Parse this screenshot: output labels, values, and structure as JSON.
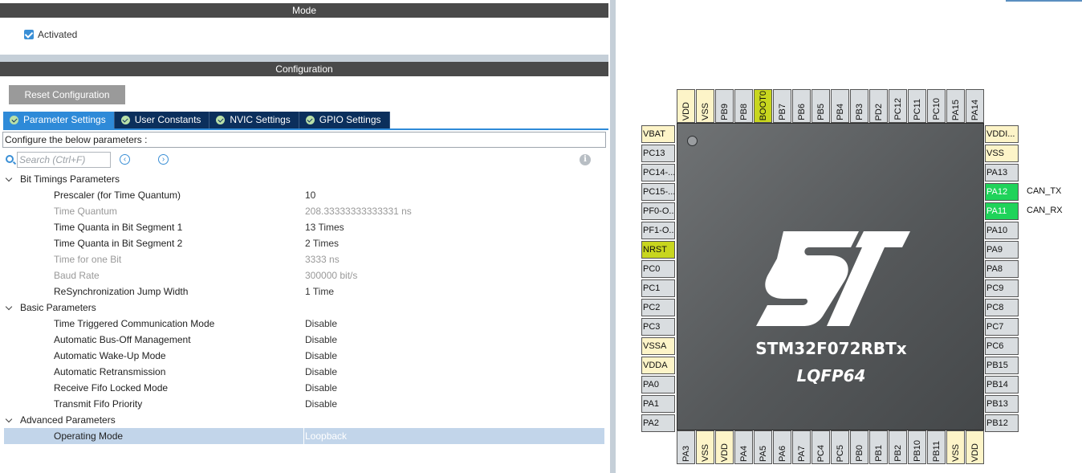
{
  "mode": {
    "title": "Mode",
    "activated_label": "Activated",
    "activated_checked": true
  },
  "configuration": {
    "title": "Configuration",
    "reset_label": "Reset Configuration",
    "tabs": [
      {
        "label": "Parameter Settings",
        "active": true
      },
      {
        "label": "User Constants",
        "active": false
      },
      {
        "label": "NVIC Settings",
        "active": false
      },
      {
        "label": "GPIO Settings",
        "active": false
      }
    ],
    "configure_text": "Configure the below parameters :",
    "search_placeholder": "Search (Ctrl+F)",
    "info_glyph": "i",
    "groups": [
      {
        "label": "Bit Timings Parameters",
        "params": [
          {
            "label": "Prescaler (for Time Quantum)",
            "value": "10",
            "dim": false
          },
          {
            "label": "Time Quantum",
            "value": "208.33333333333331 ns",
            "dim": true
          },
          {
            "label": "Time Quanta in Bit Segment 1",
            "value": "13 Times",
            "dim": false
          },
          {
            "label": "Time Quanta in Bit Segment 2",
            "value": "2 Times",
            "dim": false
          },
          {
            "label": "Time for one Bit",
            "value": "3333 ns",
            "dim": true
          },
          {
            "label": "Baud Rate",
            "value": "300000 bit/s",
            "dim": true
          },
          {
            "label": "ReSynchronization Jump Width",
            "value": "1 Time",
            "dim": false
          }
        ]
      },
      {
        "label": "Basic Parameters",
        "params": [
          {
            "label": "Time Triggered Communication Mode",
            "value": "Disable",
            "dim": false
          },
          {
            "label": "Automatic Bus-Off Management",
            "value": "Disable",
            "dim": false
          },
          {
            "label": "Automatic Wake-Up Mode",
            "value": "Disable",
            "dim": false
          },
          {
            "label": "Automatic Retransmission",
            "value": "Disable",
            "dim": false
          },
          {
            "label": "Receive Fifo Locked Mode",
            "value": "Disable",
            "dim": false
          },
          {
            "label": "Transmit Fifo Priority",
            "value": "Disable",
            "dim": false
          }
        ]
      },
      {
        "label": "Advanced Parameters",
        "params": [
          {
            "label": "Operating Mode",
            "value": "Loopback",
            "dim": false,
            "selected": true
          }
        ]
      }
    ]
  },
  "chip": {
    "name": "STM32F072RBTx",
    "package": "LQFP64",
    "pins_top": [
      {
        "name": "VDD",
        "type": "power"
      },
      {
        "name": "VSS",
        "type": "power"
      },
      {
        "name": "PB9",
        "type": "io"
      },
      {
        "name": "PB8",
        "type": "io"
      },
      {
        "name": "BOOT0",
        "type": "yellow"
      },
      {
        "name": "PB7",
        "type": "io"
      },
      {
        "name": "PB6",
        "type": "io"
      },
      {
        "name": "PB5",
        "type": "io"
      },
      {
        "name": "PB4",
        "type": "io"
      },
      {
        "name": "PB3",
        "type": "io"
      },
      {
        "name": "PD2",
        "type": "io"
      },
      {
        "name": "PC12",
        "type": "io"
      },
      {
        "name": "PC11",
        "type": "io"
      },
      {
        "name": "PC10",
        "type": "io"
      },
      {
        "name": "PA15",
        "type": "io"
      },
      {
        "name": "PA14",
        "type": "io"
      }
    ],
    "pins_left": [
      {
        "name": "VBAT",
        "type": "power"
      },
      {
        "name": "PC13",
        "type": "io"
      },
      {
        "name": "PC14-...",
        "type": "io"
      },
      {
        "name": "PC15-...",
        "type": "io"
      },
      {
        "name": "PF0-O...",
        "type": "io"
      },
      {
        "name": "PF1-O...",
        "type": "io"
      },
      {
        "name": "NRST",
        "type": "yellow"
      },
      {
        "name": "PC0",
        "type": "io"
      },
      {
        "name": "PC1",
        "type": "io"
      },
      {
        "name": "PC2",
        "type": "io"
      },
      {
        "name": "PC3",
        "type": "io"
      },
      {
        "name": "VSSA",
        "type": "power"
      },
      {
        "name": "VDDA",
        "type": "power"
      },
      {
        "name": "PA0",
        "type": "io"
      },
      {
        "name": "PA1",
        "type": "io"
      },
      {
        "name": "PA2",
        "type": "io"
      }
    ],
    "pins_right": [
      {
        "name": "VDDI...",
        "type": "power",
        "label": ""
      },
      {
        "name": "VSS",
        "type": "power",
        "label": ""
      },
      {
        "name": "PA13",
        "type": "io",
        "label": ""
      },
      {
        "name": "PA12",
        "type": "green",
        "label": "CAN_TX"
      },
      {
        "name": "PA11",
        "type": "green",
        "label": "CAN_RX"
      },
      {
        "name": "PA10",
        "type": "io",
        "label": ""
      },
      {
        "name": "PA9",
        "type": "io",
        "label": ""
      },
      {
        "name": "PA8",
        "type": "io",
        "label": ""
      },
      {
        "name": "PC9",
        "type": "io",
        "label": ""
      },
      {
        "name": "PC8",
        "type": "io",
        "label": ""
      },
      {
        "name": "PC7",
        "type": "io",
        "label": ""
      },
      {
        "name": "PC6",
        "type": "io",
        "label": ""
      },
      {
        "name": "PB15",
        "type": "io",
        "label": ""
      },
      {
        "name": "PB14",
        "type": "io",
        "label": ""
      },
      {
        "name": "PB13",
        "type": "io",
        "label": ""
      },
      {
        "name": "PB12",
        "type": "io",
        "label": ""
      }
    ],
    "pins_bottom": [
      {
        "name": "PA3",
        "type": "io"
      },
      {
        "name": "VSS",
        "type": "power"
      },
      {
        "name": "VDD",
        "type": "power"
      },
      {
        "name": "PA4",
        "type": "io"
      },
      {
        "name": "PA5",
        "type": "io"
      },
      {
        "name": "PA6",
        "type": "io"
      },
      {
        "name": "PA7",
        "type": "io"
      },
      {
        "name": "PC4",
        "type": "io"
      },
      {
        "name": "PC5",
        "type": "io"
      },
      {
        "name": "PB0",
        "type": "io"
      },
      {
        "name": "PB1",
        "type": "io"
      },
      {
        "name": "PB2",
        "type": "io"
      },
      {
        "name": "PB10",
        "type": "io"
      },
      {
        "name": "PB11",
        "type": "io"
      },
      {
        "name": "VSS",
        "type": "power"
      },
      {
        "name": "VDD",
        "type": "power"
      }
    ]
  },
  "colors": {
    "section_bar": "#4a4a4a",
    "tab_active": "#2e8ad8",
    "tab_inactive": "#0b2f5c",
    "pin_green": "#1fd35a",
    "pin_yellow": "#c8d61e",
    "pin_power": "#fdf4c8",
    "pin_io": "#d9dde0"
  }
}
